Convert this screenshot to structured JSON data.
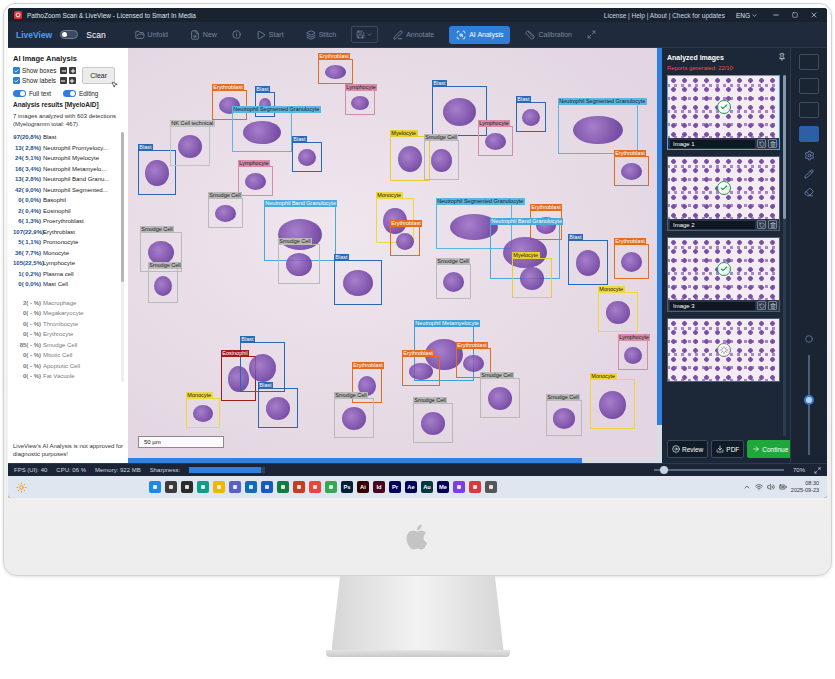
{
  "window": {
    "title": "PathoZoom Scan & LiveView - Licensed to Smart In Media",
    "menu": "License | Help | About | Check for updates",
    "language": "ENG"
  },
  "toolbar": {
    "live_label": "LiveView",
    "scan_label": "Scan",
    "scan_on": false,
    "items": [
      {
        "label": "Unfold",
        "disabled": true,
        "selected": false
      },
      {
        "label": "New",
        "disabled": true,
        "selected": false
      },
      {
        "label": "Start",
        "disabled": true,
        "selected": false
      },
      {
        "label": "Stitch",
        "disabled": true,
        "selected": false
      },
      {
        "label": "Annotate",
        "disabled": true,
        "selected": false
      },
      {
        "label": "AI Analysis",
        "disabled": false,
        "selected": true
      },
      {
        "label": "Calibration",
        "disabled": true,
        "selected": false
      }
    ]
  },
  "ai_panel": {
    "title": "AI Image Analysis",
    "checkboxes": [
      {
        "label": "Show boxes",
        "checked": true
      },
      {
        "label": "Show labels",
        "checked": true
      }
    ],
    "clear_button": "Clear",
    "toggles": [
      {
        "label": "Full text",
        "on": true
      },
      {
        "label": "Editing",
        "on": true
      }
    ],
    "results_title": "Analysis results [MyeloAID]",
    "summary": "7 images analyzed with 603 detections",
    "summary_sub": "(Myelogramm total: 467)",
    "results": [
      {
        "count": "97(20,8%)",
        "label": "Blast",
        "dimmed": false
      },
      {
        "count": "13( 2,8%)",
        "label": "Neutrophil Promyelocy...",
        "dimmed": false
      },
      {
        "count": "24( 5,1%)",
        "label": "Neutrophil Myelocyte",
        "dimmed": false
      },
      {
        "count": "16( 3,4%)",
        "label": "Neutrophil Metamyelo...",
        "dimmed": false
      },
      {
        "count": "13( 2,8%)",
        "label": "Neutrophil Band Granu...",
        "dimmed": false
      },
      {
        "count": "42( 9,0%)",
        "label": "Neutrophil Segmented...",
        "dimmed": false
      },
      {
        "count": "0( 0,0%)",
        "label": "Basophil",
        "dimmed": false
      },
      {
        "count": "2( 0,4%)",
        "label": "Eosinophil",
        "dimmed": false
      },
      {
        "count": "6( 1,3%)",
        "label": "Proerythroblast",
        "dimmed": false
      },
      {
        "count": "107(22,9%)",
        "label": "Erythroblast",
        "dimmed": false
      },
      {
        "count": "5( 1,1%)",
        "label": "Promonocyte",
        "dimmed": false
      },
      {
        "count": "36( 7,7%)",
        "label": "Monocyte",
        "dimmed": false
      },
      {
        "count": "105(22,5%)",
        "label": "Lymphocyte",
        "dimmed": false
      },
      {
        "count": "1( 0,2%)",
        "label": "Plasma cell",
        "dimmed": false
      },
      {
        "count": "0( 0,0%)",
        "label": "Mast Cell",
        "dimmed": false
      },
      {
        "count": "2( - %)",
        "label": "Macrophage",
        "dimmed": true
      },
      {
        "count": "0( - %)",
        "label": "Megakaryocyte",
        "dimmed": true
      },
      {
        "count": "0( - %)",
        "label": "Thrombocyte",
        "dimmed": true
      },
      {
        "count": "0( - %)",
        "label": "Erythrocyte",
        "dimmed": true
      },
      {
        "count": "85( - %)",
        "label": "Smudge Cell",
        "dimmed": true
      },
      {
        "count": "0( - %)",
        "label": "Mitotic Cell",
        "dimmed": true
      },
      {
        "count": "0( - %)",
        "label": "Apoptotic Cell",
        "dimmed": true
      },
      {
        "count": "0( - %)",
        "label": "Fat Vacuole",
        "dimmed": true
      }
    ],
    "disclaimer": "LiveView's AI Analysis is not approved for diagnostic purposes!"
  },
  "image": {
    "scale": "50 µm",
    "detections": [
      {
        "label": "Blast",
        "color": "#2b67b3"
      },
      {
        "label": "Erythroblast",
        "color": "#e36c1e"
      },
      {
        "label": "Blast",
        "color": "#2b67b3"
      },
      {
        "label": "Erythroblast",
        "color": "#e36c1e"
      },
      {
        "label": "Lymphocyte",
        "color": "#d78ba9"
      },
      {
        "label": "Neutrophil Segmented Granulocyte",
        "color": "#5ab6e4"
      },
      {
        "label": "NK Cell technical",
        "color": "#c2c2c2"
      },
      {
        "label": "Lymphocyte",
        "color": "#d78ba9"
      },
      {
        "label": "Blast",
        "color": "#2b67b3"
      },
      {
        "label": "Neutrophil Band Granulocyte",
        "color": "#4aa9dc"
      },
      {
        "label": "Smudge Cell",
        "color": "#b9b9b9"
      },
      {
        "label": "Smudge Cell",
        "color": "#b9b9b9"
      },
      {
        "label": "Smudge Cell",
        "color": "#b9b9b9"
      },
      {
        "label": "Blast",
        "color": "#2b67b3"
      },
      {
        "label": "Blast",
        "color": "#2b67b3"
      },
      {
        "label": "Neutrophil Segmented Granulocyte",
        "color": "#5ab6e4"
      },
      {
        "label": "Lymphocyte",
        "color": "#d78ba9"
      },
      {
        "label": "Myelocyte",
        "color": "#e8cf2f"
      },
      {
        "label": "Smudge Cell",
        "color": "#b9b9b9"
      },
      {
        "label": "Erythroblast",
        "color": "#e36c1e"
      },
      {
        "label": "Monocyte",
        "color": "#efd83c"
      },
      {
        "label": "Neutrophil Segmented Granulocyte",
        "color": "#5ab6e4"
      },
      {
        "label": "Erythroblast",
        "color": "#e36c1e"
      },
      {
        "label": "Neutrophil Band Granulocyte",
        "color": "#4aa9dc"
      },
      {
        "label": "Erythroblast",
        "color": "#e36c1e"
      },
      {
        "label": "Smudge Cell",
        "color": "#b9b9b9"
      },
      {
        "label": "Blast",
        "color": "#2b67b3"
      },
      {
        "label": "Smudge Cell",
        "color": "#b9b9b9"
      },
      {
        "label": "Myelocyte",
        "color": "#e8cf2f"
      },
      {
        "label": "Blast",
        "color": "#2b67b3"
      },
      {
        "label": "Erythroblast",
        "color": "#e36c1e"
      },
      {
        "label": "Monocyte",
        "color": "#efd83c"
      },
      {
        "label": "Neutrophil Metamyelocyte",
        "color": "#3d9fd6"
      },
      {
        "label": "Erythroblast",
        "color": "#e36c1e"
      },
      {
        "label": "Erythroblast",
        "color": "#e36c1e"
      },
      {
        "label": "Eosinophil",
        "color": "#a3191c"
      },
      {
        "label": "Blast",
        "color": "#2b67b3"
      },
      {
        "label": "Blast",
        "color": "#2b67b3"
      },
      {
        "label": "Erythroblast",
        "color": "#e36c1e"
      },
      {
        "label": "Smudge Cell",
        "color": "#b9b9b9"
      },
      {
        "label": "Smudge Cell",
        "color": "#b9b9b9"
      },
      {
        "label": "Smudge Cell",
        "color": "#b9b9b9"
      },
      {
        "label": "Smudge Cell",
        "color": "#b9b9b9"
      },
      {
        "label": "Monocyte",
        "color": "#efd83c"
      },
      {
        "label": "Lymphocyte",
        "color": "#d78ba9"
      },
      {
        "label": "Monocyte",
        "color": "#efd83c"
      }
    ]
  },
  "analyzed": {
    "title": "Analyzed images",
    "reports": "Reports generated: 22/10",
    "images": [
      {
        "label": "Image 1",
        "selected": true,
        "status": "done"
      },
      {
        "label": "Image 2",
        "selected": false,
        "status": "done"
      },
      {
        "label": "Image 3",
        "selected": false,
        "status": "done"
      },
      {
        "label": "",
        "selected": false,
        "status": "pending"
      }
    ],
    "buttons": [
      {
        "label": "Review",
        "kind": "plain"
      },
      {
        "label": "PDF",
        "kind": "plain"
      },
      {
        "label": "Continue",
        "kind": "primary"
      }
    ]
  },
  "side_tools": {
    "buttons": [
      {
        "selected": false
      },
      {
        "selected": false
      },
      {
        "selected": false
      },
      {
        "selected": true
      }
    ],
    "slider": {
      "level": 0.55
    }
  },
  "status_bar": {
    "fps": "FPS (UI): 40",
    "cpu": "CPU: 06 %",
    "memory": "Memory: 922 MB",
    "sharpness_label": "Sharpness:",
    "sharpness": {
      "level": 0.95
    },
    "zoom": {
      "level": 0.08,
      "reading": "70%"
    }
  },
  "taskbar": {
    "apps": [
      {
        "kind": "icon",
        "label": "",
        "color": "#1e88e5"
      },
      {
        "kind": "icon",
        "label": "",
        "color": "#3a3a3a"
      },
      {
        "kind": "icon",
        "label": "",
        "color": "#2b2b2b"
      },
      {
        "kind": "icon",
        "label": "",
        "color": "#0f9d8a"
      },
      {
        "kind": "icon",
        "label": "",
        "color": "#f2b600"
      },
      {
        "kind": "icon",
        "label": "",
        "color": "#5b5fc7"
      },
      {
        "kind": "icon",
        "label": "",
        "color": "#0f6cbd"
      },
      {
        "kind": "icon",
        "label": "",
        "color": "#185abd"
      },
      {
        "kind": "icon",
        "label": "",
        "color": "#107c41"
      },
      {
        "kind": "icon",
        "label": "",
        "color": "#c43e1c"
      },
      {
        "kind": "icon",
        "label": "",
        "color": "#e8453c"
      },
      {
        "kind": "icon",
        "label": "",
        "color": "#34a853"
      },
      {
        "kind": "badge",
        "label": "Ps",
        "color": "#001e36"
      },
      {
        "kind": "badge",
        "label": "Ai",
        "color": "#330000"
      },
      {
        "kind": "badge",
        "label": "Id",
        "color": "#49021f"
      },
      {
        "kind": "badge",
        "label": "Pr",
        "color": "#00005b"
      },
      {
        "kind": "badge",
        "label": "Ae",
        "color": "#00005b"
      },
      {
        "kind": "badge",
        "label": "Au",
        "color": "#00363d"
      },
      {
        "kind": "badge",
        "label": "Me",
        "color": "#00005b"
      },
      {
        "kind": "icon",
        "label": "",
        "color": "#7b3fe4"
      },
      {
        "kind": "icon",
        "label": "",
        "color": "#d63a3a"
      },
      {
        "kind": "icon",
        "label": "",
        "color": "#555555"
      }
    ],
    "time": "08:30",
    "date": "2025-09-23"
  }
}
